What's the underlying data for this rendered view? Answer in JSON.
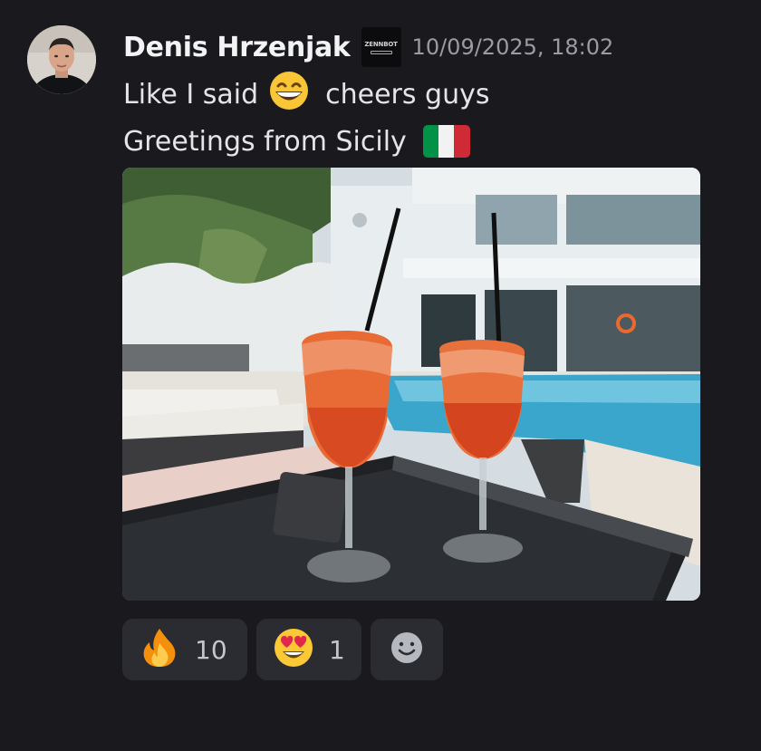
{
  "message": {
    "author": "Denis Hrzenjak",
    "badge_text": "ZENNBOT",
    "timestamp": "10/09/2025, 18:02",
    "line1_before": "Like I said",
    "line1_emoji": "grinning-face",
    "line1_after": "cheers guys",
    "line2_text": "Greetings from Sicily",
    "line2_emoji": "flag-italy",
    "attachment": "photo of two spritz cocktails on a poolside table"
  },
  "reactions": [
    {
      "emoji": "fire",
      "count": "10"
    },
    {
      "emoji": "heart-eyes",
      "count": "1"
    }
  ],
  "colors": {
    "background": "#1a1a1e",
    "reaction_bg": "#2b2c31",
    "timestamp": "#9a9ba3",
    "username": "#f2f3f5",
    "flag_green": "#009246",
    "flag_white": "#f1f2f1",
    "flag_red": "#ce2b37"
  }
}
